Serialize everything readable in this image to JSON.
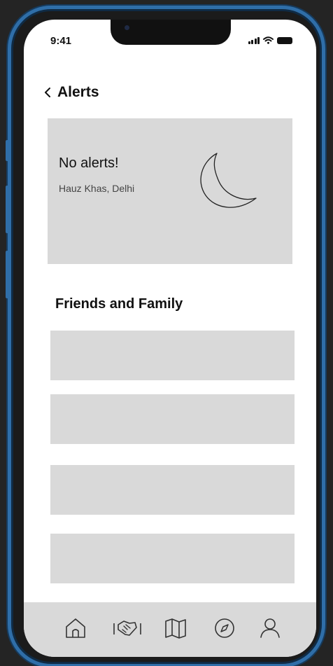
{
  "status_bar": {
    "time": "9:41"
  },
  "header": {
    "back_icon": "chevron-left-icon",
    "title": "Alerts"
  },
  "alert_card": {
    "title": "No alerts!",
    "location": "Hauz Khas, Delhi",
    "icon": "moon-icon"
  },
  "friends_section": {
    "title": "Friends and Family",
    "rows": [
      "",
      "",
      "",
      ""
    ]
  },
  "tab_bar": {
    "items": [
      {
        "name": "home",
        "icon": "home-icon"
      },
      {
        "name": "handshake",
        "icon": "handshake-icon"
      },
      {
        "name": "map",
        "icon": "map-icon"
      },
      {
        "name": "explore",
        "icon": "compass-icon"
      },
      {
        "name": "profile",
        "icon": "user-icon"
      }
    ]
  },
  "colors": {
    "frame_accent": "#2f6ea8",
    "card_background": "#d9d9d9",
    "screen_background": "#ffffff",
    "text_primary": "#111111"
  }
}
